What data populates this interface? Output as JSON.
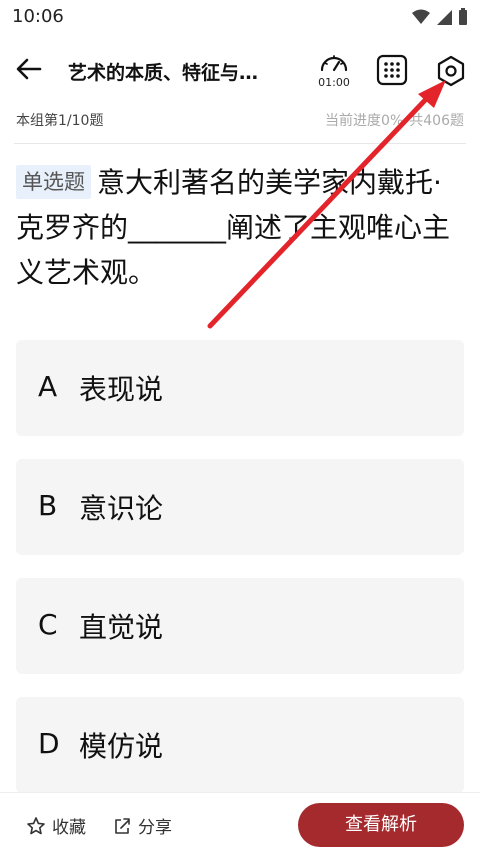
{
  "status_bar": {
    "time": "10:06"
  },
  "header": {
    "title": "艺术的本质、特征与…",
    "timer": "01:00"
  },
  "progress": {
    "group": "本组第1/10题",
    "current": "当前进度0%",
    "total": "共406题"
  },
  "question": {
    "type_tag": "单选题",
    "text": "意大利著名的美学家内戴托·克罗齐的_______阐述了主观唯心主义艺术观。"
  },
  "options": [
    {
      "letter": "A",
      "text": "表现说"
    },
    {
      "letter": "B",
      "text": "意识论"
    },
    {
      "letter": "C",
      "text": "直觉说"
    },
    {
      "letter": "D",
      "text": "模仿说"
    }
  ],
  "footer": {
    "favorite": "收藏",
    "share": "分享",
    "analysis": "查看解析"
  },
  "colors": {
    "accent": "#a52a2e",
    "annotation": "#e3242b",
    "option_bg": "#f5f5f5"
  }
}
